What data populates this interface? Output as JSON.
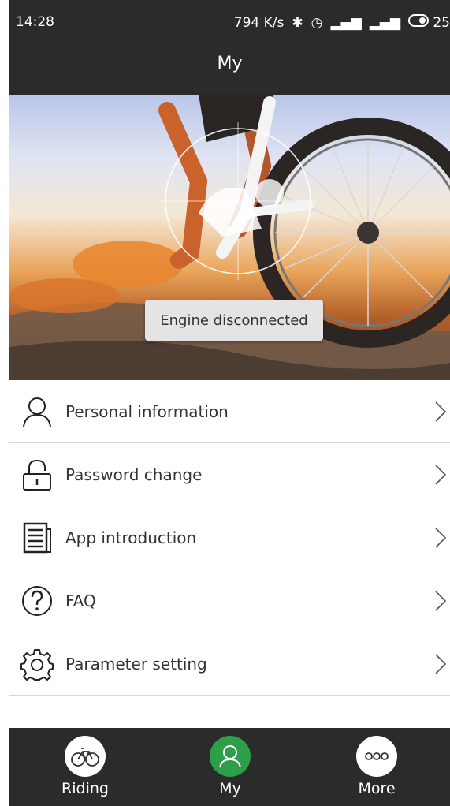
{
  "status_bar": {
    "time": "14:28",
    "speed": "794 K/s",
    "battery": "25"
  },
  "header": {
    "title": "My"
  },
  "hero": {
    "toast": "Engine disconnected"
  },
  "menu": {
    "items": [
      {
        "label": "Personal information",
        "icon": "person-icon"
      },
      {
        "label": "Password change",
        "icon": "lock-icon"
      },
      {
        "label": "App introduction",
        "icon": "document-icon"
      },
      {
        "label": "FAQ",
        "icon": "question-icon"
      },
      {
        "label": "Parameter setting",
        "icon": "gear-icon"
      }
    ]
  },
  "bottom_nav": {
    "active": "My",
    "accent": "#2e9e4a",
    "items": [
      {
        "label": "Riding",
        "icon": "bicycle-icon"
      },
      {
        "label": "My",
        "icon": "person-icon"
      },
      {
        "label": "More",
        "icon": "more-dots-icon"
      }
    ]
  }
}
